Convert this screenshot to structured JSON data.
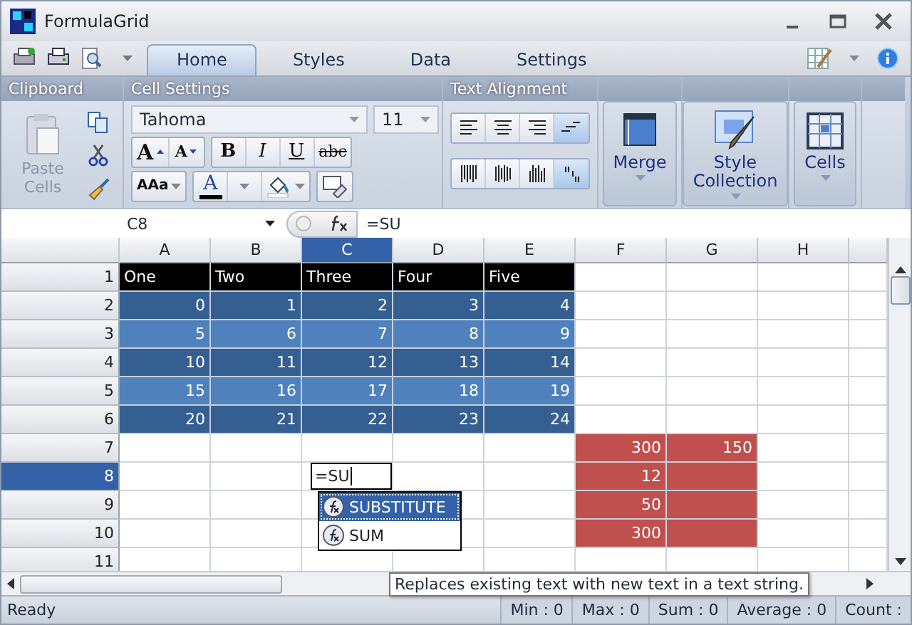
{
  "window": {
    "title": "FormulaGrid"
  },
  "tabs": [
    {
      "label": "Home",
      "selected": true
    },
    {
      "label": "Styles",
      "selected": false
    },
    {
      "label": "Data",
      "selected": false
    },
    {
      "label": "Settings",
      "selected": false
    }
  ],
  "ribbon": {
    "groups": [
      "Clipboard",
      "Cell Settings",
      "Text Alignment"
    ],
    "paste": {
      "label": "Paste Cells",
      "disabled": true
    },
    "font": {
      "name": "Tahoma",
      "size": "11"
    },
    "size_buttons": [
      {
        "label": "A",
        "kind": "grow"
      },
      {
        "label": "A",
        "kind": "shrink"
      }
    ],
    "style_buttons": [
      {
        "label": "B",
        "kind": "bold"
      },
      {
        "label": "I",
        "kind": "italic"
      },
      {
        "label": "U",
        "kind": "underline"
      },
      {
        "label": "abc",
        "kind": "strike"
      }
    ],
    "case_button": {
      "label": "AAa"
    },
    "font_color_button": {
      "label": "A"
    },
    "horizontal_align": [
      {
        "kind": "left",
        "selected": false
      },
      {
        "kind": "center",
        "selected": false
      },
      {
        "kind": "right",
        "selected": false
      },
      {
        "kind": "fill",
        "selected": true
      }
    ],
    "vertical_align": [
      {
        "kind": "top",
        "selected": false
      },
      {
        "kind": "middle",
        "selected": false
      },
      {
        "kind": "bottom",
        "selected": false
      },
      {
        "kind": "stagger",
        "selected": true
      }
    ],
    "big_buttons": [
      {
        "label": "Merge",
        "kind": "merge"
      },
      {
        "label": "Style Collection",
        "kind": "style"
      },
      {
        "label": "Cells",
        "kind": "cells"
      }
    ]
  },
  "formula_bar": {
    "name_box": "C8",
    "formula": "=SU"
  },
  "sheet": {
    "columns": [
      {
        "label": "A",
        "selected": false
      },
      {
        "label": "B",
        "selected": false
      },
      {
        "label": "C",
        "selected": true
      },
      {
        "label": "D",
        "selected": false
      },
      {
        "label": "E",
        "selected": false
      },
      {
        "label": "F",
        "selected": false
      },
      {
        "label": "G",
        "selected": false
      },
      {
        "label": "H",
        "selected": false
      }
    ],
    "rows": [
      {
        "label": "1",
        "selected": false,
        "cells": [
          {
            "kind": "header",
            "text": "One"
          },
          {
            "kind": "header",
            "text": "Two"
          },
          {
            "kind": "header",
            "text": "Three"
          },
          {
            "kind": "header",
            "text": "Four"
          },
          {
            "kind": "header",
            "text": "Five"
          },
          {
            "kind": "none"
          },
          {
            "kind": "none"
          },
          {
            "kind": "none"
          }
        ]
      },
      {
        "label": "2",
        "selected": false,
        "cells": [
          {
            "kind": "dark",
            "text": "0"
          },
          {
            "kind": "dark",
            "text": "1"
          },
          {
            "kind": "dark",
            "text": "2"
          },
          {
            "kind": "dark",
            "text": "3"
          },
          {
            "kind": "dark",
            "text": "4"
          },
          {
            "kind": "none"
          },
          {
            "kind": "none"
          },
          {
            "kind": "none"
          }
        ]
      },
      {
        "label": "3",
        "selected": false,
        "cells": [
          {
            "kind": "light",
            "text": "5"
          },
          {
            "kind": "light",
            "text": "6"
          },
          {
            "kind": "light",
            "text": "7"
          },
          {
            "kind": "light",
            "text": "8"
          },
          {
            "kind": "light",
            "text": "9"
          },
          {
            "kind": "none"
          },
          {
            "kind": "none"
          },
          {
            "kind": "none"
          }
        ]
      },
      {
        "label": "4",
        "selected": false,
        "cells": [
          {
            "kind": "dark",
            "text": "10"
          },
          {
            "kind": "dark",
            "text": "11"
          },
          {
            "kind": "dark",
            "text": "12"
          },
          {
            "kind": "dark",
            "text": "13"
          },
          {
            "kind": "dark",
            "text": "14"
          },
          {
            "kind": "none"
          },
          {
            "kind": "none"
          },
          {
            "kind": "none"
          }
        ]
      },
      {
        "label": "5",
        "selected": false,
        "cells": [
          {
            "kind": "light",
            "text": "15"
          },
          {
            "kind": "light",
            "text": "16"
          },
          {
            "kind": "light",
            "text": "17"
          },
          {
            "kind": "light",
            "text": "18"
          },
          {
            "kind": "light",
            "text": "19"
          },
          {
            "kind": "none"
          },
          {
            "kind": "none"
          },
          {
            "kind": "none"
          }
        ]
      },
      {
        "label": "6",
        "selected": false,
        "cells": [
          {
            "kind": "dark",
            "text": "20"
          },
          {
            "kind": "dark",
            "text": "21"
          },
          {
            "kind": "dark",
            "text": "22"
          },
          {
            "kind": "dark",
            "text": "23"
          },
          {
            "kind": "dark",
            "text": "24"
          },
          {
            "kind": "none"
          },
          {
            "kind": "none"
          },
          {
            "kind": "none"
          }
        ]
      },
      {
        "label": "7",
        "selected": false,
        "cells": [
          {
            "kind": "none"
          },
          {
            "kind": "none"
          },
          {
            "kind": "none"
          },
          {
            "kind": "none"
          },
          {
            "kind": "none"
          },
          {
            "kind": "red",
            "text": "300"
          },
          {
            "kind": "red",
            "text": "150"
          },
          {
            "kind": "none"
          }
        ]
      },
      {
        "label": "8",
        "selected": true,
        "cells": [
          {
            "kind": "none"
          },
          {
            "kind": "none"
          },
          {
            "kind": "editing",
            "text": "=SU"
          },
          {
            "kind": "none"
          },
          {
            "kind": "none"
          },
          {
            "kind": "red",
            "text": "12"
          },
          {
            "kind": "red"
          },
          {
            "kind": "none"
          }
        ]
      },
      {
        "label": "9",
        "selected": false,
        "cells": [
          {
            "kind": "none"
          },
          {
            "kind": "none"
          },
          {
            "kind": "none"
          },
          {
            "kind": "none"
          },
          {
            "kind": "none"
          },
          {
            "kind": "red",
            "text": "50"
          },
          {
            "kind": "red"
          },
          {
            "kind": "none"
          }
        ]
      },
      {
        "label": "10",
        "selected": false,
        "cells": [
          {
            "kind": "none"
          },
          {
            "kind": "none"
          },
          {
            "kind": "none"
          },
          {
            "kind": "none"
          },
          {
            "kind": "none"
          },
          {
            "kind": "red",
            "text": "300"
          },
          {
            "kind": "red"
          },
          {
            "kind": "none"
          }
        ]
      },
      {
        "label": "11",
        "selected": false,
        "cells": [
          {
            "kind": "none"
          },
          {
            "kind": "none"
          },
          {
            "kind": "none"
          },
          {
            "kind": "none"
          },
          {
            "kind": "none"
          },
          {
            "kind": "none"
          },
          {
            "kind": "none"
          },
          {
            "kind": "none"
          }
        ]
      }
    ]
  },
  "autocomplete": [
    {
      "label": "SUBSTITUTE",
      "selected": true
    },
    {
      "label": "SUM",
      "selected": false
    }
  ],
  "tooltip": "Replaces existing text with new text in a text string.",
  "status_bar": {
    "message": "Ready",
    "stats": [
      "Min : 0",
      "Max : 0",
      "Sum : 0",
      "Average : 0",
      "Count :"
    ]
  }
}
